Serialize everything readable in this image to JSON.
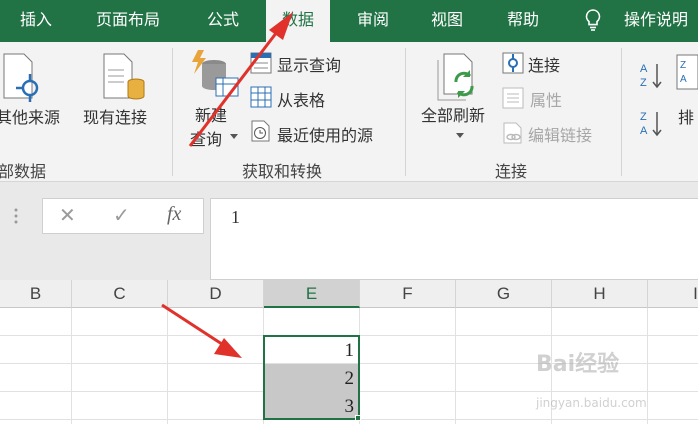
{
  "tabs": [
    {
      "label": "插入"
    },
    {
      "label": "页面布局"
    },
    {
      "label": "公式"
    },
    {
      "label": "数据",
      "active": true
    },
    {
      "label": "审阅"
    },
    {
      "label": "视图"
    },
    {
      "label": "帮助"
    },
    {
      "label": "操作说明"
    }
  ],
  "ribbon": {
    "get_external": {
      "button_label": "其他来源",
      "group_label": "部数据"
    },
    "existing_connections_label": "现有连接",
    "get_transform": {
      "new_query_line1": "新建",
      "new_query_line2": "查询",
      "show_queries": "显示查询",
      "from_table": "从表格",
      "recent_sources": "最近使用的源",
      "group_label": "获取和转换"
    },
    "connections": {
      "refresh_all": "全部刷新",
      "connections": "连接",
      "properties": "属性",
      "edit_links": "编辑链接",
      "group_label": "连接"
    },
    "sort": {
      "sort_label": "排"
    }
  },
  "formula_bar": {
    "cancel_symbol": "✕",
    "enter_symbol": "✓",
    "fx_symbol": "fx",
    "value": "1"
  },
  "grid": {
    "columns": [
      "B",
      "C",
      "D",
      "E",
      "F",
      "G",
      "H",
      "I"
    ],
    "selected_column": "E",
    "cells": [
      "1",
      "2",
      "3"
    ]
  },
  "watermark": {
    "main": "Bai经验",
    "sub": "jingyan.baidu.com"
  },
  "colors": {
    "accent": "#217346",
    "arrow": "#e0322b",
    "selection": "#c8c8c8"
  }
}
